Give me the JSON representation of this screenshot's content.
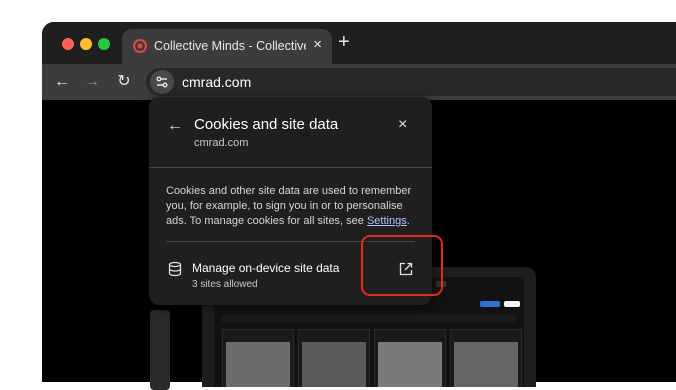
{
  "browser": {
    "tab": {
      "title": "Collective Minds - Collective I",
      "close_glyph": "×",
      "favicon_icon": "collective-minds-icon"
    },
    "new_tab_glyph": "+",
    "nav": {
      "back_glyph": "←",
      "forward_glyph": "→",
      "reload_glyph": "↻"
    },
    "address": {
      "url": "cmrad.com",
      "site_info_icon": "tune-icon"
    }
  },
  "popup": {
    "back_glyph": "←",
    "title": "Cookies and site data",
    "subtitle": "cmrad.com",
    "close_glyph": "×",
    "description_text": "Cookies and other site data are used to remember you, for example, to sign you in or to personalise ads. To manage cookies for all sites, see ",
    "settings_link": "Settings",
    "description_end": ".",
    "manage": {
      "title": "Manage on-device site data",
      "subtitle": "3 sites allowed",
      "icon": "database-icon",
      "action_icon": "open-in-new-icon"
    }
  },
  "colors": {
    "popup_bg": "#1f1f1f",
    "link": "#a8c7fa",
    "highlight": "#e8271f"
  }
}
